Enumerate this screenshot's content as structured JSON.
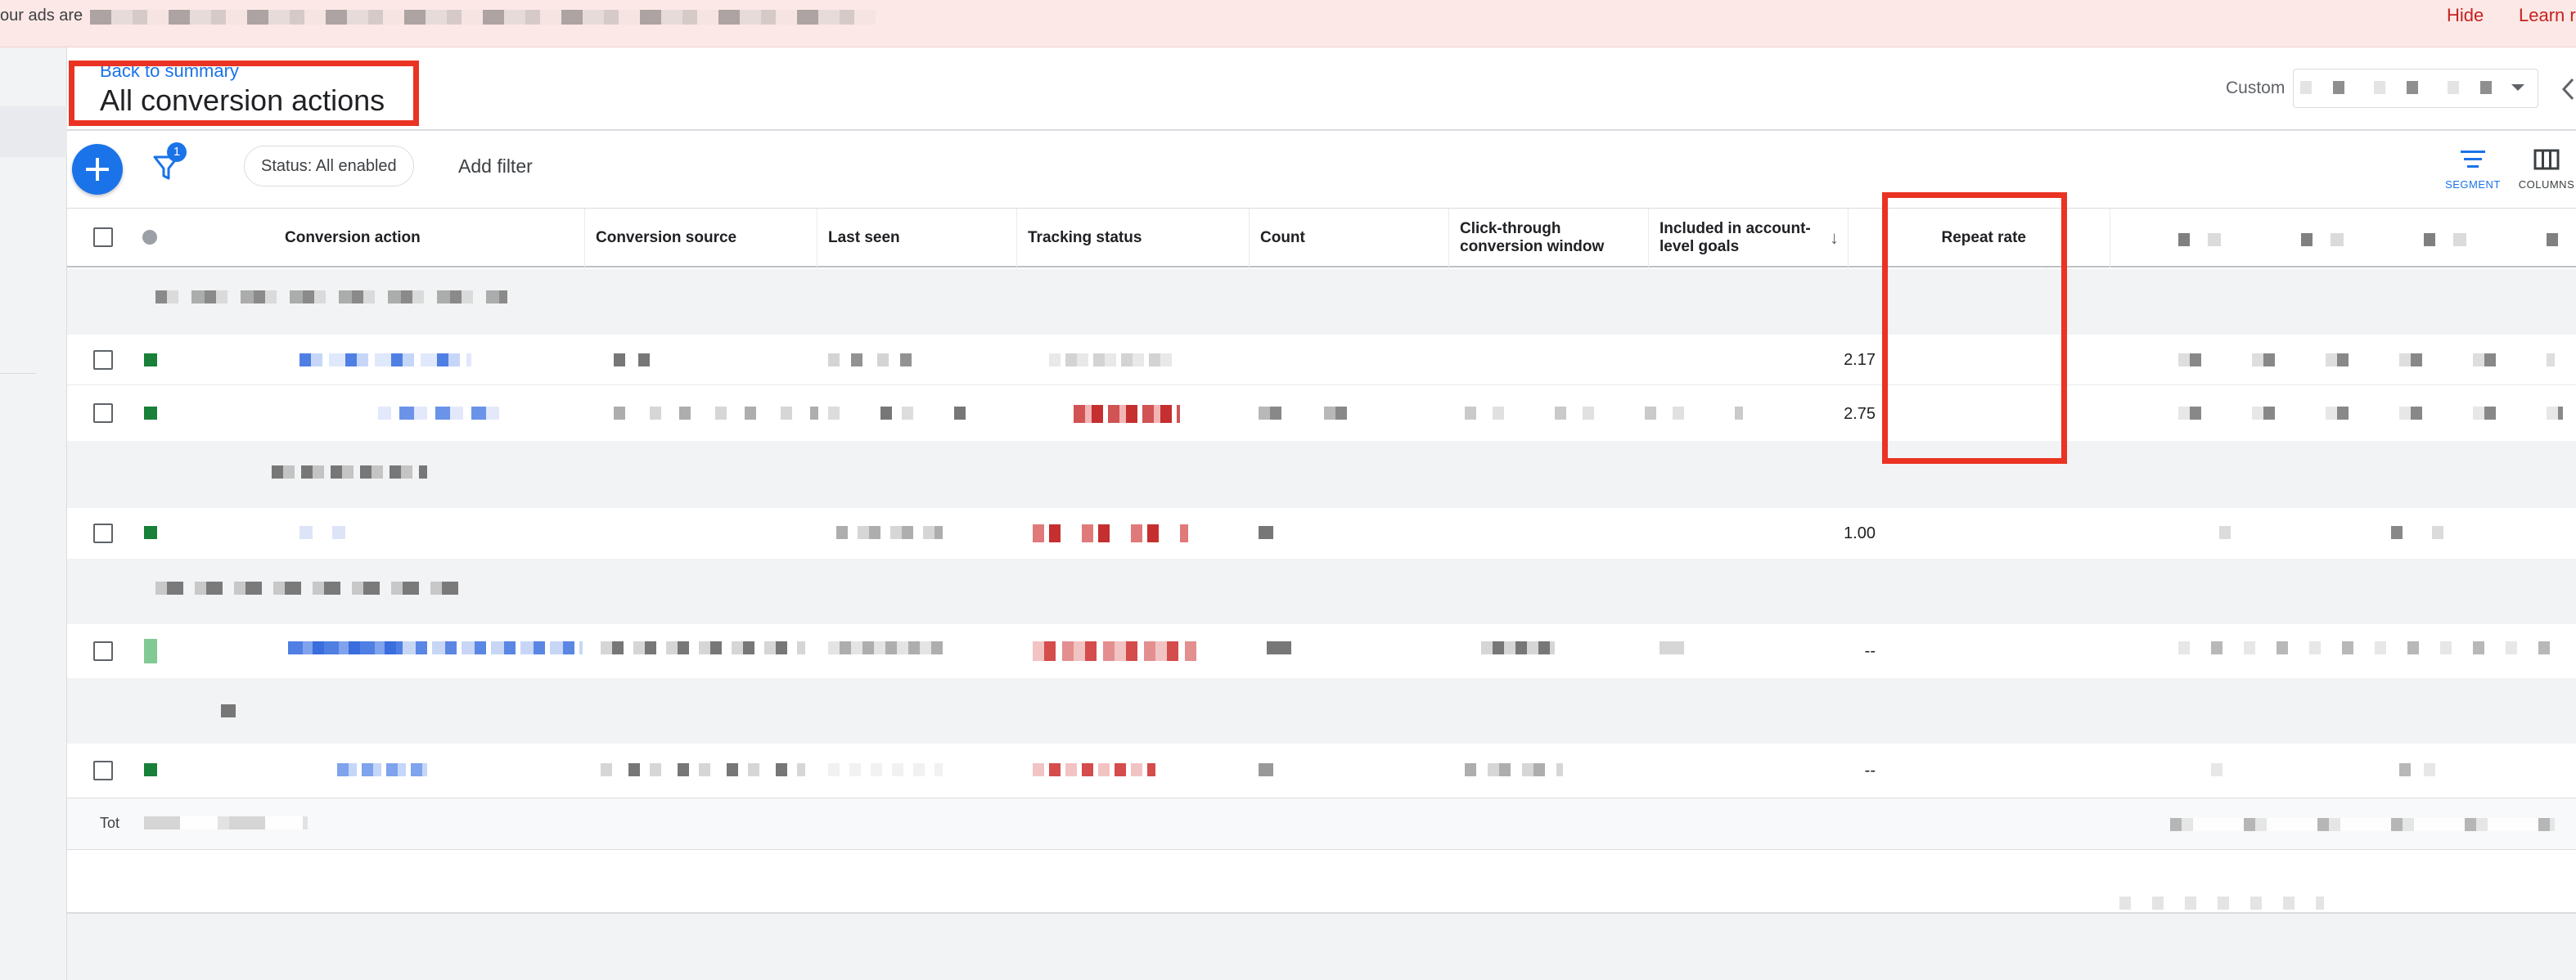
{
  "banner": {
    "text": "our ads are",
    "hide_label": "Hide",
    "learn_label": "Learn r"
  },
  "header": {
    "back_link": "Back to summary",
    "title": "All conversion actions",
    "date_label": "Custom"
  },
  "toolbar": {
    "filter_count": "1",
    "status_chip": "Status: All enabled",
    "add_filter": "Add filter",
    "segment_label": "SEGMENT",
    "columns_label": "COLUMNS"
  },
  "table": {
    "columns": {
      "conversion_action": "Conversion action",
      "conversion_source": "Conversion source",
      "last_seen": "Last seen",
      "tracking_status": "Tracking status",
      "count": "Count",
      "ct_window": "Click-through conversion window",
      "included": "Included in account-level goals",
      "repeat_rate": "Repeat rate"
    },
    "rows": [
      {
        "repeat_rate": "2.17"
      },
      {
        "repeat_rate": "2.75"
      },
      {
        "repeat_rate": "1.00"
      },
      {
        "repeat_rate": "--"
      },
      {
        "repeat_rate": "--"
      }
    ],
    "total_label": "Tot"
  },
  "colors": {
    "accent": "#1a73e8",
    "status_green": "#188038",
    "highlight_red": "#ea3323",
    "error_red": "#c5221f"
  },
  "icons": {
    "add": "plus-icon",
    "filter": "filter-funnel-icon",
    "segment": "segment-icon",
    "columns": "columns-icon",
    "sort": "arrow-down-icon",
    "dropdown": "caret-down-icon",
    "collapse": "chevron-left-icon"
  }
}
